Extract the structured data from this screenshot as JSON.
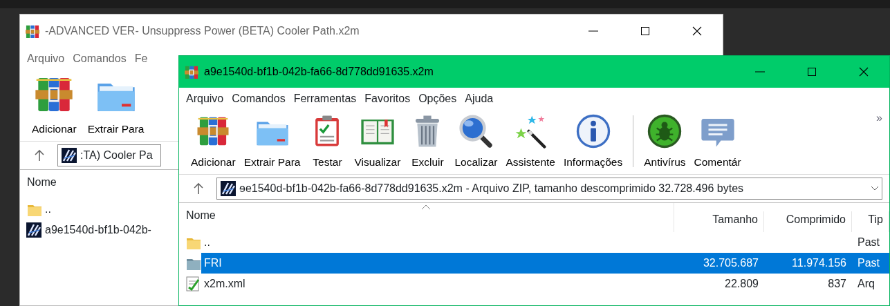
{
  "back_window": {
    "title": "-ADVANCED VER- Unsuppress Power (BETA) Cooler Path.x2m",
    "menu": [
      "Arquivo",
      "Comandos",
      "Fe"
    ],
    "toolbar": [
      {
        "kind": "add",
        "label": "Adicionar"
      },
      {
        "kind": "extract",
        "label": "Extrair Para"
      }
    ],
    "address": ":TA) Cooler Pa",
    "columns": [
      "Nome"
    ],
    "rows": [
      {
        "kind": "parent",
        "name": ".."
      },
      {
        "kind": "x2m",
        "name": "a9e1540d-bf1b-042b-"
      }
    ]
  },
  "front_window": {
    "title": "a9e1540d-bf1b-042b-fa66-8d778dd91635.x2m",
    "menu": [
      "Arquivo",
      "Comandos",
      "Ferramentas",
      "Favoritos",
      "Opções",
      "Ajuda"
    ],
    "toolbar": [
      {
        "kind": "add",
        "label": "Adicionar"
      },
      {
        "kind": "extract",
        "label": "Extrair Para"
      },
      {
        "kind": "test",
        "label": "Testar"
      },
      {
        "kind": "view",
        "label": "Visualizar"
      },
      {
        "kind": "delete",
        "label": "Excluir"
      },
      {
        "kind": "find",
        "label": "Localizar"
      },
      {
        "kind": "wizard",
        "label": "Assistente"
      },
      {
        "kind": "info",
        "label": "Informações"
      },
      {
        "kind": "antivirus",
        "label": "Antivírus"
      },
      {
        "kind": "comment",
        "label": "Comentár"
      }
    ],
    "toolbar_overflow": "»",
    "address": "ɘe1540d-bf1b-042b-fa66-8d778dd91635.x2m - Arquivo ZIP, tamanho descomprimido 32.728.496 bytes",
    "columns": [
      "Nome",
      "Tamanho",
      "Comprimido",
      "Tip"
    ],
    "rows": [
      {
        "kind": "parent",
        "name": "..",
        "type": "Past",
        "selected": false
      },
      {
        "kind": "folder",
        "name": "FRI",
        "size": "32.705.687",
        "packed": "11.974.156",
        "type": "Past",
        "selected": true
      },
      {
        "kind": "xml",
        "name": "x2m.xml",
        "size": "22.809",
        "packed": "837",
        "type": "Arq",
        "selected": false
      }
    ]
  }
}
